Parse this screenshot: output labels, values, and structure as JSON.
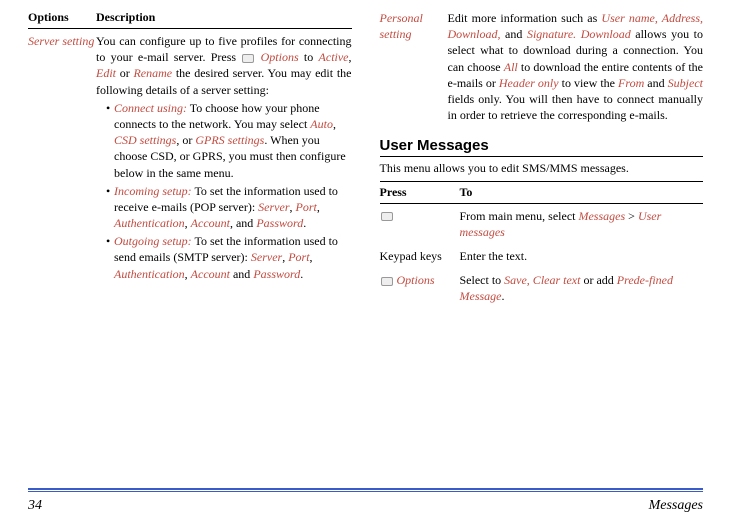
{
  "left": {
    "header": {
      "c1": "Options",
      "c2": "Description"
    },
    "row1_label": "Server setting",
    "row1_desc_pre": "You can configure up to five profiles for connecting to your e-mail server. Press ",
    "row1_options": "Options",
    "row1_to": " to ",
    "row1_active": "Active",
    "row1_comma": ", ",
    "row1_edit": "Edit",
    "row1_or": " or ",
    "row1_rename": "Rename",
    "row1_desc_post": " the desired server. You may edit the following details of a server setting:",
    "b1_head": "Connect using:",
    "b1_rest1": " To choose how your phone connects to the network. You may select ",
    "b1_auto": "Auto",
    "b1_c1": ", ",
    "b1_csd": "CSD settings",
    "b1_c2": ", or ",
    "b1_gprs": "GPRS settings",
    "b1_rest2": ". When you choose CSD, or GPRS, you must then configure below in the same menu.",
    "b2_head": "Incoming setup:",
    "b2_rest1": " To set the information used to receive e-mails (POP server): ",
    "b2_server": "Server",
    "b2_c1": ", ",
    "b2_port": "Port",
    "b2_c2": ", ",
    "b2_auth": "Authentication",
    "b2_c3": ", ",
    "b2_acct": "Account",
    "b2_c4": ", and ",
    "b2_pass": "Password",
    "b2_dot": ".",
    "b3_head": "Outgoing setup:",
    "b3_rest1": " To set the information used to send emails (SMTP server): ",
    "b3_server": "Server",
    "b3_c1": ", ",
    "b3_port": "Port",
    "b3_c2": ", ",
    "b3_auth": "Authentication",
    "b3_c3": ", ",
    "b3_acct": "Account",
    "b3_and": " and ",
    "b3_pass": "Password",
    "b3_dot": "."
  },
  "right": {
    "row1_label": "Personal setting",
    "r1_pre": "Edit more information such as ",
    "r1_user": "User name,",
    "r1_addr": " Address,",
    "r1_dl": " Download,",
    "r1_and": " and ",
    "r1_sig": "Signature.",
    "r1_dl2": " Download",
    "r1_mid": " allows you to select what to download during a connection. You can choose ",
    "r1_all": "All",
    "r1_mid2": " to download the entire contents of the e-mails or ",
    "r1_header": "Header only",
    "r1_mid3": " to view the ",
    "r1_from": "From",
    "r1_and2": " and ",
    "r1_subj": "Subject",
    "r1_end": " fields only. You will then have to connect manually in order to retrieve the corresponding e-mails.",
    "section_title": "User Messages",
    "section_desc": "This menu allows you to edit SMS/MMS messages.",
    "press_header": {
      "c1": "Press",
      "c2": "To"
    },
    "pr1_c2a": "From main menu, select ",
    "pr1_msgs": "Messages",
    "pr1_gt": " > ",
    "pr1_um": "User messages",
    "pr2_c1": "Keypad keys",
    "pr2_c2": "Enter the text.",
    "pr3_opt": "Options",
    "pr3_pre": "Select to ",
    "pr3_save": "Save, Clear text",
    "pr3_mid": " or add ",
    "pr3_pre2": "Prede-fined Message",
    "pr3_dot": "."
  },
  "footer": {
    "page": "34",
    "section": "Messages"
  }
}
